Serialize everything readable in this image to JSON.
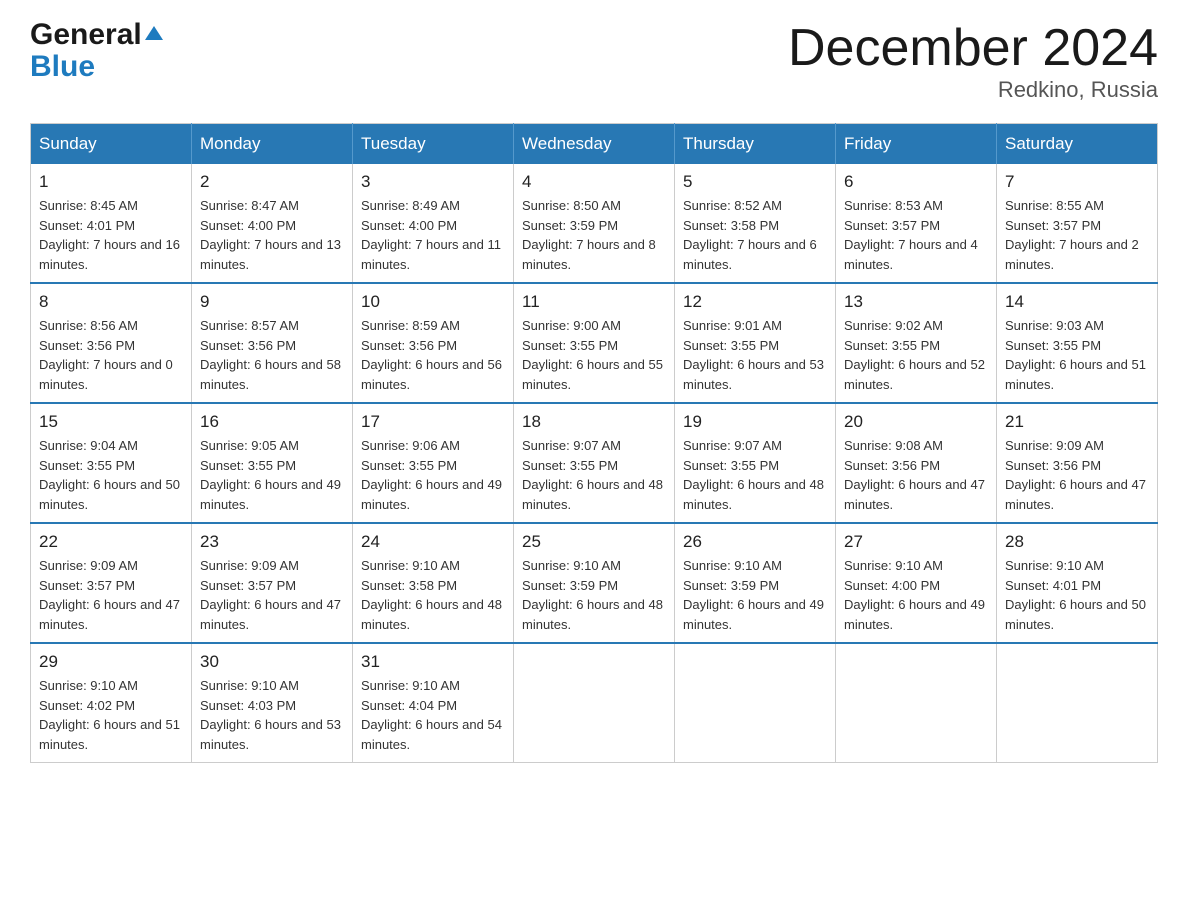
{
  "logo": {
    "general": "General",
    "blue": "Blue",
    "triangle_char": "▲"
  },
  "title": "December 2024",
  "subtitle": "Redkino, Russia",
  "days_of_week": [
    "Sunday",
    "Monday",
    "Tuesday",
    "Wednesday",
    "Thursday",
    "Friday",
    "Saturday"
  ],
  "weeks": [
    [
      {
        "day": "1",
        "sunrise": "8:45 AM",
        "sunset": "4:01 PM",
        "daylight": "7 hours and 16 minutes."
      },
      {
        "day": "2",
        "sunrise": "8:47 AM",
        "sunset": "4:00 PM",
        "daylight": "7 hours and 13 minutes."
      },
      {
        "day": "3",
        "sunrise": "8:49 AM",
        "sunset": "4:00 PM",
        "daylight": "7 hours and 11 minutes."
      },
      {
        "day": "4",
        "sunrise": "8:50 AM",
        "sunset": "3:59 PM",
        "daylight": "7 hours and 8 minutes."
      },
      {
        "day": "5",
        "sunrise": "8:52 AM",
        "sunset": "3:58 PM",
        "daylight": "7 hours and 6 minutes."
      },
      {
        "day": "6",
        "sunrise": "8:53 AM",
        "sunset": "3:57 PM",
        "daylight": "7 hours and 4 minutes."
      },
      {
        "day": "7",
        "sunrise": "8:55 AM",
        "sunset": "3:57 PM",
        "daylight": "7 hours and 2 minutes."
      }
    ],
    [
      {
        "day": "8",
        "sunrise": "8:56 AM",
        "sunset": "3:56 PM",
        "daylight": "7 hours and 0 minutes."
      },
      {
        "day": "9",
        "sunrise": "8:57 AM",
        "sunset": "3:56 PM",
        "daylight": "6 hours and 58 minutes."
      },
      {
        "day": "10",
        "sunrise": "8:59 AM",
        "sunset": "3:56 PM",
        "daylight": "6 hours and 56 minutes."
      },
      {
        "day": "11",
        "sunrise": "9:00 AM",
        "sunset": "3:55 PM",
        "daylight": "6 hours and 55 minutes."
      },
      {
        "day": "12",
        "sunrise": "9:01 AM",
        "sunset": "3:55 PM",
        "daylight": "6 hours and 53 minutes."
      },
      {
        "day": "13",
        "sunrise": "9:02 AM",
        "sunset": "3:55 PM",
        "daylight": "6 hours and 52 minutes."
      },
      {
        "day": "14",
        "sunrise": "9:03 AM",
        "sunset": "3:55 PM",
        "daylight": "6 hours and 51 minutes."
      }
    ],
    [
      {
        "day": "15",
        "sunrise": "9:04 AM",
        "sunset": "3:55 PM",
        "daylight": "6 hours and 50 minutes."
      },
      {
        "day": "16",
        "sunrise": "9:05 AM",
        "sunset": "3:55 PM",
        "daylight": "6 hours and 49 minutes."
      },
      {
        "day": "17",
        "sunrise": "9:06 AM",
        "sunset": "3:55 PM",
        "daylight": "6 hours and 49 minutes."
      },
      {
        "day": "18",
        "sunrise": "9:07 AM",
        "sunset": "3:55 PM",
        "daylight": "6 hours and 48 minutes."
      },
      {
        "day": "19",
        "sunrise": "9:07 AM",
        "sunset": "3:55 PM",
        "daylight": "6 hours and 48 minutes."
      },
      {
        "day": "20",
        "sunrise": "9:08 AM",
        "sunset": "3:56 PM",
        "daylight": "6 hours and 47 minutes."
      },
      {
        "day": "21",
        "sunrise": "9:09 AM",
        "sunset": "3:56 PM",
        "daylight": "6 hours and 47 minutes."
      }
    ],
    [
      {
        "day": "22",
        "sunrise": "9:09 AM",
        "sunset": "3:57 PM",
        "daylight": "6 hours and 47 minutes."
      },
      {
        "day": "23",
        "sunrise": "9:09 AM",
        "sunset": "3:57 PM",
        "daylight": "6 hours and 47 minutes."
      },
      {
        "day": "24",
        "sunrise": "9:10 AM",
        "sunset": "3:58 PM",
        "daylight": "6 hours and 48 minutes."
      },
      {
        "day": "25",
        "sunrise": "9:10 AM",
        "sunset": "3:59 PM",
        "daylight": "6 hours and 48 minutes."
      },
      {
        "day": "26",
        "sunrise": "9:10 AM",
        "sunset": "3:59 PM",
        "daylight": "6 hours and 49 minutes."
      },
      {
        "day": "27",
        "sunrise": "9:10 AM",
        "sunset": "4:00 PM",
        "daylight": "6 hours and 49 minutes."
      },
      {
        "day": "28",
        "sunrise": "9:10 AM",
        "sunset": "4:01 PM",
        "daylight": "6 hours and 50 minutes."
      }
    ],
    [
      {
        "day": "29",
        "sunrise": "9:10 AM",
        "sunset": "4:02 PM",
        "daylight": "6 hours and 51 minutes."
      },
      {
        "day": "30",
        "sunrise": "9:10 AM",
        "sunset": "4:03 PM",
        "daylight": "6 hours and 53 minutes."
      },
      {
        "day": "31",
        "sunrise": "9:10 AM",
        "sunset": "4:04 PM",
        "daylight": "6 hours and 54 minutes."
      },
      null,
      null,
      null,
      null
    ]
  ],
  "labels": {
    "sunrise": "Sunrise:",
    "sunset": "Sunset:",
    "daylight": "Daylight:"
  }
}
